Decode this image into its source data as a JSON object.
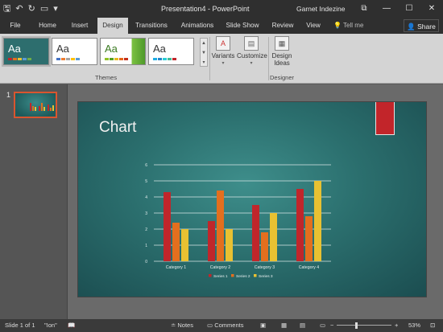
{
  "titlebar": {
    "doc_title": "Presentation4 - PowerPoint",
    "user": "Garnet Indezine",
    "qat_icons": [
      "save-icon",
      "undo-icon",
      "redo-icon",
      "start-from-beginning-icon",
      "customize-qat-icon"
    ],
    "restore_glyph": "⧉",
    "minimize_glyph": "—",
    "maximize_glyph": "☐",
    "close_glyph": "✕"
  },
  "tabs": [
    "File",
    "Home",
    "Insert",
    "Design",
    "Transitions",
    "Animations",
    "Slide Show",
    "Review",
    "View"
  ],
  "active_tab": "Design",
  "tell_me": "Tell me",
  "share": "Share",
  "ribbon": {
    "themes_label": "Themes",
    "theme_thumb_text": "Aa",
    "variants": "Variants",
    "customize": "Customize",
    "design_ideas_line1": "Design",
    "design_ideas_line2": "Ideas",
    "designer_label": "Designer"
  },
  "slide_panel": {
    "slide_number": "1"
  },
  "slide": {
    "title": "Chart"
  },
  "chart_data": {
    "type": "bar",
    "categories": [
      "Category 1",
      "Category 2",
      "Category 3",
      "Category 4"
    ],
    "series": [
      {
        "name": "Series 1",
        "color": "#c0262b",
        "values": [
          4.3,
          2.5,
          3.5,
          4.5
        ]
      },
      {
        "name": "Series 2",
        "color": "#e36f1e",
        "values": [
          2.4,
          4.4,
          1.8,
          2.8
        ]
      },
      {
        "name": "Series 3",
        "color": "#e8c132",
        "values": [
          2,
          2,
          3,
          5
        ]
      }
    ],
    "ylim": [
      0,
      6
    ],
    "yticks": [
      "0",
      "1",
      "2",
      "3",
      "4",
      "5",
      "6"
    ],
    "grid": true,
    "legend": "bottom"
  },
  "status": {
    "slide_info": "Slide 1 of 1",
    "theme": "\"Ion\"",
    "notes": "Notes",
    "comments": "Comments",
    "zoom": "53%"
  },
  "colors": {
    "accent_orange": "#d9552f",
    "ribbon_bg": "#d4d4d4",
    "titlebar_bg": "#2f2f2f"
  }
}
